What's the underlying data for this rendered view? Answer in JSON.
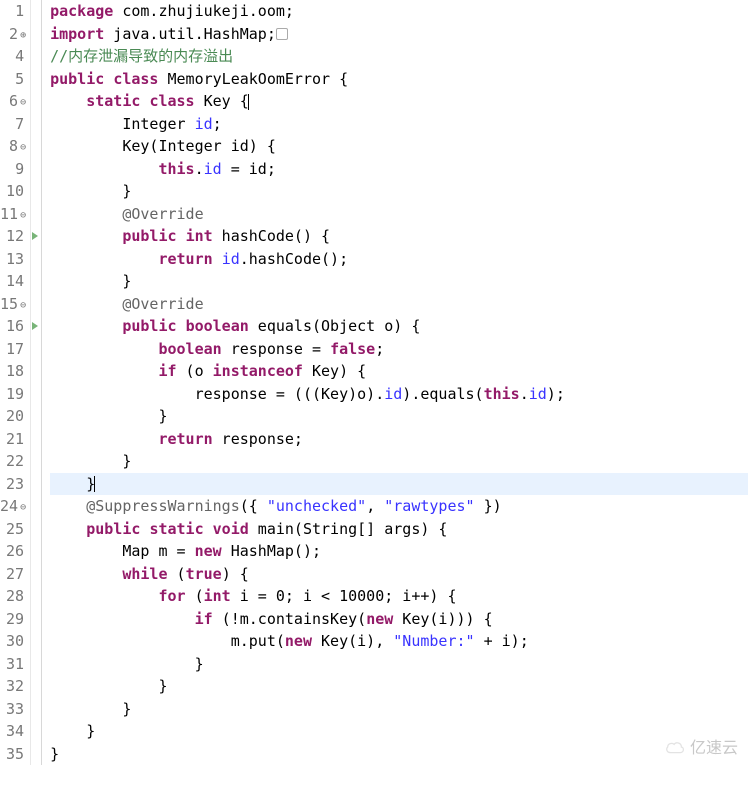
{
  "watermark": "亿速云",
  "lines": [
    {
      "n": 1,
      "g": "plain",
      "ann": "",
      "html": "<span class='kw'>package</span> <span class='pkg'>com.zhujiukeji.oom</span>;"
    },
    {
      "n": 2,
      "g": "plus",
      "ann": "",
      "html": "<span class='kw'>import</span> java.util.HashMap;<span class='foldbox'>&nbsp;</span>"
    },
    {
      "n": 4,
      "g": "plain",
      "ann": "",
      "html": "<span class='comment'>//内存泄漏导致的内存溢出</span>"
    },
    {
      "n": 5,
      "g": "plain",
      "ann": "",
      "html": "<span class='kw'>public</span> <span class='kw'>class</span> MemoryLeakOomError {"
    },
    {
      "n": 6,
      "g": "fold",
      "ann": "",
      "html": "    <span class='kw'>static</span> <span class='kw'>class</span> Key {<span class='cursor'></span>"
    },
    {
      "n": 7,
      "g": "plain",
      "ann": "",
      "html": "        Integer <span class='field'>id</span>;"
    },
    {
      "n": 8,
      "g": "fold",
      "ann": "",
      "html": "        Key(Integer id) {"
    },
    {
      "n": 9,
      "g": "plain",
      "ann": "",
      "html": "            <span class='kw'>this</span>.<span class='field'>id</span> = id;"
    },
    {
      "n": 10,
      "g": "plain",
      "ann": "",
      "html": "        }"
    },
    {
      "n": 11,
      "g": "fold",
      "ann": "",
      "html": "        <span class='ann-code'>@Override</span>"
    },
    {
      "n": 12,
      "g": "plain",
      "ann": "tri",
      "html": "        <span class='kw'>public</span> <span class='kw'>int</span> hashCode() {"
    },
    {
      "n": 13,
      "g": "plain",
      "ann": "",
      "html": "            <span class='kw'>return</span> <span class='field'>id</span>.hashCode();"
    },
    {
      "n": 14,
      "g": "plain",
      "ann": "",
      "html": "        }"
    },
    {
      "n": 15,
      "g": "fold",
      "ann": "",
      "html": "        <span class='ann-code'>@Override</span>"
    },
    {
      "n": 16,
      "g": "plain",
      "ann": "tri",
      "html": "        <span class='kw'>public</span> <span class='kw'>boolean</span> equals(Object o) {"
    },
    {
      "n": 17,
      "g": "plain",
      "ann": "",
      "html": "            <span class='kw'>boolean</span> response = <span class='kw'>false</span>;"
    },
    {
      "n": 18,
      "g": "plain",
      "ann": "",
      "html": "            <span class='kw'>if</span> (o <span class='kw'>instanceof</span> Key) {"
    },
    {
      "n": 19,
      "g": "plain",
      "ann": "",
      "html": "                response = (((Key)o).<span class='field'>id</span>).equals(<span class='kw'>this</span>.<span class='field'>id</span>);"
    },
    {
      "n": 20,
      "g": "plain",
      "ann": "",
      "html": "            }"
    },
    {
      "n": 21,
      "g": "plain",
      "ann": "",
      "html": "            <span class='kw'>return</span> response;"
    },
    {
      "n": 22,
      "g": "plain",
      "ann": "",
      "html": "        }"
    },
    {
      "n": 23,
      "g": "plain",
      "ann": "",
      "current": true,
      "html": "    }<span class='cursor'></span>"
    },
    {
      "n": 24,
      "g": "fold",
      "ann": "",
      "html": "    <span class='ann-code'>@SuppressWarnings</span>({ <span class='str'>\"unchecked\"</span>, <span class='str'>\"rawtypes\"</span> })"
    },
    {
      "n": 25,
      "g": "plain",
      "ann": "",
      "html": "    <span class='kw'>public</span> <span class='kw'>static</span> <span class='kw'>void</span> main(String[] args) {"
    },
    {
      "n": 26,
      "g": "plain",
      "ann": "",
      "html": "        Map m = <span class='kw'>new</span> HashMap();"
    },
    {
      "n": 27,
      "g": "plain",
      "ann": "",
      "html": "        <span class='kw'>while</span> (<span class='kw'>true</span>) {"
    },
    {
      "n": 28,
      "g": "plain",
      "ann": "",
      "html": "            <span class='kw'>for</span> (<span class='kw'>int</span> i = 0; i &lt; 10000; i++) {"
    },
    {
      "n": 29,
      "g": "plain",
      "ann": "",
      "html": "                <span class='kw'>if</span> (!m.containsKey(<span class='kw'>new</span> Key(i))) {"
    },
    {
      "n": 30,
      "g": "plain",
      "ann": "",
      "html": "                    m.put(<span class='kw'>new</span> Key(i), <span class='str'>\"Number:\"</span> + i);"
    },
    {
      "n": 31,
      "g": "plain",
      "ann": "",
      "html": "                }"
    },
    {
      "n": 32,
      "g": "plain",
      "ann": "",
      "html": "            }"
    },
    {
      "n": 33,
      "g": "plain",
      "ann": "",
      "html": "        }"
    },
    {
      "n": 34,
      "g": "plain",
      "ann": "",
      "html": "    }"
    },
    {
      "n": 35,
      "g": "plain",
      "ann": "",
      "html": "}"
    }
  ]
}
